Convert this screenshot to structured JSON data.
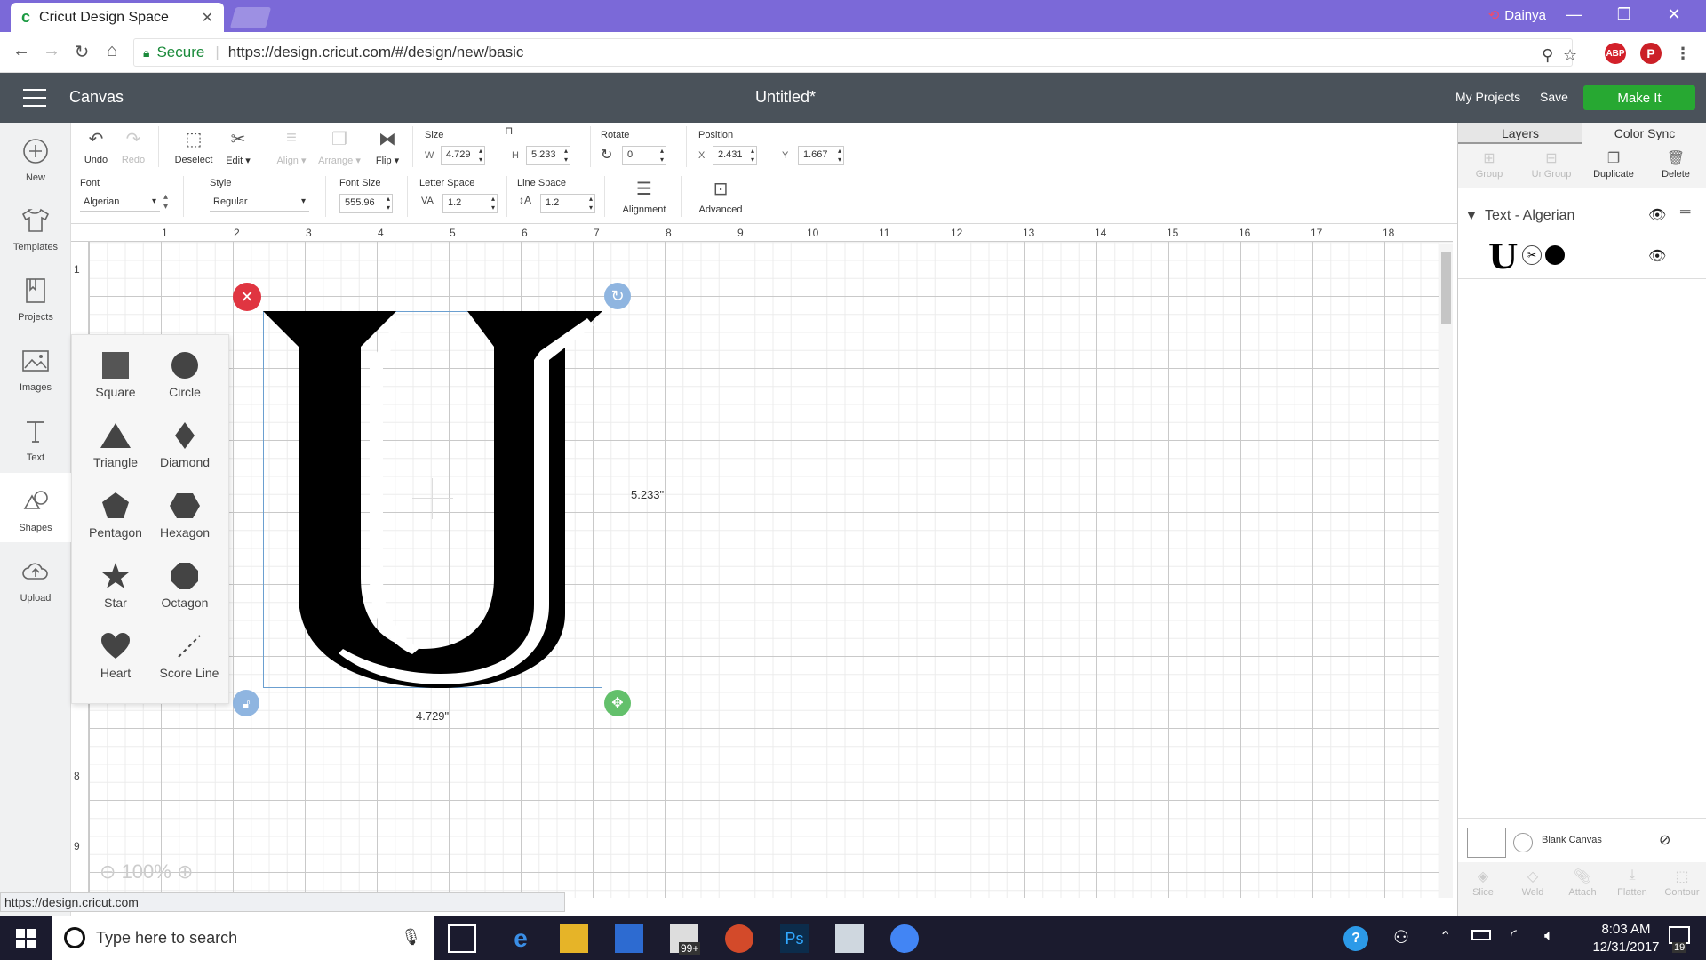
{
  "browser": {
    "tab_title": "Cricut Design Space",
    "profile_name": "Dainya",
    "secure_label": "Secure",
    "url": "https://design.cricut.com/#/design/new/basic",
    "status_url": "https://design.cricut.com"
  },
  "header": {
    "app_title": "Canvas",
    "doc_title": "Untitled*",
    "my_projects": "My Projects",
    "save": "Save",
    "make_it": "Make It"
  },
  "sidebar": {
    "items": [
      {
        "label": "New",
        "icon": "plus-icon"
      },
      {
        "label": "Templates",
        "icon": "shirt-icon"
      },
      {
        "label": "Projects",
        "icon": "bookmark-icon"
      },
      {
        "label": "Images",
        "icon": "image-icon"
      },
      {
        "label": "Text",
        "icon": "text-icon"
      },
      {
        "label": "Shapes",
        "icon": "shapes-icon"
      },
      {
        "label": "Upload",
        "icon": "upload-cloud-icon"
      }
    ]
  },
  "toolbar": {
    "undo": "Undo",
    "redo": "Redo",
    "deselect": "Deselect",
    "edit": "Edit",
    "align": "Align",
    "arrange": "Arrange",
    "flip": "Flip",
    "size_label": "Size",
    "w_label": "W",
    "w_value": "4.729",
    "h_label": "H",
    "h_value": "5.233",
    "rotate_label": "Rotate",
    "rotate_value": "0",
    "position_label": "Position",
    "x_label": "X",
    "x_value": "2.431",
    "y_label": "Y",
    "y_value": "1.667"
  },
  "text_toolbar": {
    "font_label": "Font",
    "font_value": "Algerian",
    "style_label": "Style",
    "style_value": "Regular",
    "font_size_label": "Font Size",
    "font_size_value": "555.96",
    "letter_space_label": "Letter Space",
    "letter_space_value": "1.2",
    "line_space_label": "Line Space",
    "line_space_value": "1.2",
    "alignment": "Alignment",
    "advanced": "Advanced"
  },
  "canvas": {
    "ruler_top": [
      "1",
      "2",
      "3",
      "4",
      "5",
      "6",
      "7",
      "8",
      "9",
      "10",
      "11",
      "12",
      "13",
      "14",
      "15",
      "16",
      "17",
      "18"
    ],
    "ruler_left": [
      "1",
      "8",
      "9"
    ],
    "height_readout": "5.233\"",
    "width_readout": "4.729\"",
    "zoom": "100%",
    "letter": "U"
  },
  "shapes_panel": {
    "items": [
      "Square",
      "Circle",
      "Triangle",
      "Diamond",
      "Pentagon",
      "Hexagon",
      "Star",
      "Octagon",
      "Heart",
      "Score Line"
    ]
  },
  "layers_panel": {
    "tab_layers": "Layers",
    "tab_color_sync": "Color Sync",
    "group": "Group",
    "ungroup": "UnGroup",
    "duplicate": "Duplicate",
    "delete": "Delete",
    "layer_name": "Text - Algerian",
    "blank_canvas": "Blank Canvas",
    "slice": "Slice",
    "weld": "Weld",
    "attach": "Attach",
    "flatten": "Flatten",
    "contour": "Contour"
  },
  "taskbar": {
    "search_placeholder": "Type here to search",
    "mail_badge": "99+",
    "time": "8:03 AM",
    "date": "12/31/2017",
    "notif_count": "19"
  },
  "colors": {
    "tabbar": "#7b69d8",
    "header": "#4a525a",
    "make_it": "#27a832",
    "taskbar": "#1b1b2e"
  }
}
